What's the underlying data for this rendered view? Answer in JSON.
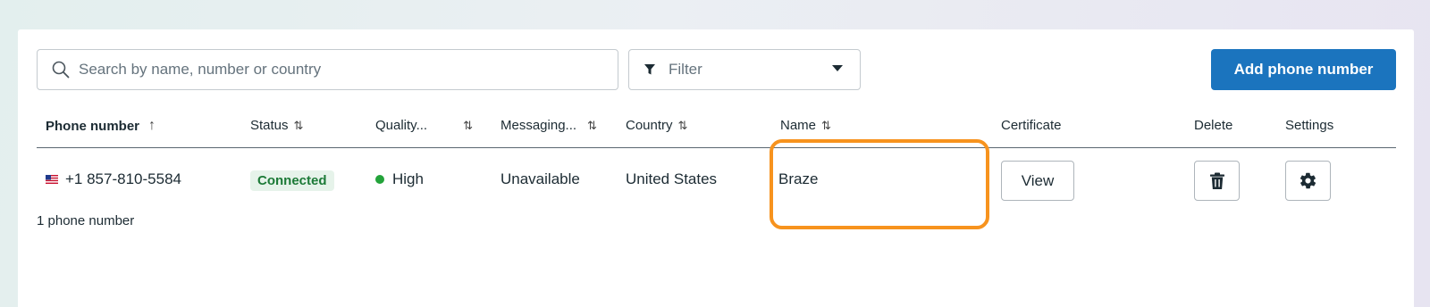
{
  "search": {
    "placeholder": "Search by name, number or country",
    "value": ""
  },
  "filter": {
    "label": "Filter"
  },
  "toolbar": {
    "add_label": "Add phone number"
  },
  "table": {
    "headers": {
      "phone": "Phone number",
      "status": "Status",
      "quality": "Quality...",
      "messaging": "Messaging...",
      "country": "Country",
      "name": "Name",
      "certificate": "Certificate",
      "delete": "Delete",
      "settings": "Settings"
    },
    "sort_icons": {
      "ascending": "↑",
      "both": "⇅"
    },
    "rows": [
      {
        "phone": "+1 857-810-5584",
        "status": "Connected",
        "quality": "High",
        "messaging": "Unavailable",
        "country": "United States",
        "name": "Braze",
        "certificate_label": "View"
      }
    ],
    "footer": "1 phone number"
  },
  "colors": {
    "primary": "#1b74be",
    "status_connected": "#1c7a37",
    "quality_high": "#23a33a",
    "highlight": "#f7931e"
  },
  "icons": {
    "search": "search-icon",
    "filter": "filter-icon",
    "dropdown": "caret-down-icon",
    "flag": "us-flag-icon",
    "delete": "trash-icon",
    "settings": "gear-icon"
  }
}
